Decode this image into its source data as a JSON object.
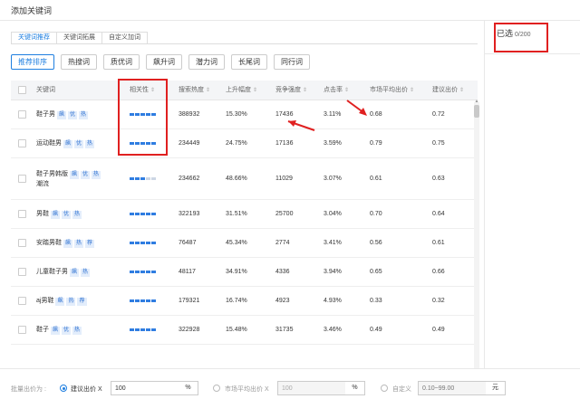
{
  "dialog": {
    "title": "添加关键词"
  },
  "tabs": [
    "关键词推荐",
    "关键词拓展",
    "自定义加词"
  ],
  "filters": [
    "推荐排序",
    "热搜词",
    "质优词",
    "飙升词",
    "潜力词",
    "长尾词",
    "同行词"
  ],
  "table": {
    "columns": [
      "关键词",
      "相关性",
      "搜索热度",
      "上升幅度",
      "竞争强度",
      "点击率",
      "市场平均出价",
      "建议出价"
    ],
    "rows": [
      {
        "keyword": "鞋子男",
        "keyword_line2": "",
        "badges": [
          "飙",
          "优",
          "热"
        ],
        "relevance_level": 5,
        "heat": "388932",
        "rise": "15.30%",
        "competition": "17436",
        "ctr": "3.11%",
        "avg_bid": "0.68",
        "suggest_bid": "0.72"
      },
      {
        "keyword": "运动鞋男",
        "keyword_line2": "",
        "badges": [
          "飙",
          "优",
          "热"
        ],
        "relevance_level": 5,
        "heat": "234449",
        "rise": "24.75%",
        "competition": "17136",
        "ctr": "3.59%",
        "avg_bid": "0.79",
        "suggest_bid": "0.75"
      },
      {
        "keyword": "鞋子男韩版",
        "keyword_line2": "潮流",
        "badges": [
          "飙",
          "优",
          "热"
        ],
        "relevance_level": 3,
        "heat": "234662",
        "rise": "48.66%",
        "competition": "11029",
        "ctr": "3.07%",
        "avg_bid": "0.61",
        "suggest_bid": "0.63"
      },
      {
        "keyword": "男鞋",
        "keyword_line2": "",
        "badges": [
          "飙",
          "优",
          "热"
        ],
        "relevance_level": 5,
        "heat": "322193",
        "rise": "31.51%",
        "competition": "25700",
        "ctr": "3.04%",
        "avg_bid": "0.70",
        "suggest_bid": "0.64"
      },
      {
        "keyword": "安踏男鞋",
        "keyword_line2": "",
        "badges": [
          "飙",
          "热",
          "荐"
        ],
        "relevance_level": 5,
        "heat": "76487",
        "rise": "45.34%",
        "competition": "2774",
        "ctr": "3.41%",
        "avg_bid": "0.56",
        "suggest_bid": "0.61"
      },
      {
        "keyword": "儿童鞋子男",
        "keyword_line2": "",
        "badges": [
          "飙",
          "热"
        ],
        "relevance_level": 5,
        "heat": "48117",
        "rise": "34.91%",
        "competition": "4336",
        "ctr": "3.94%",
        "avg_bid": "0.65",
        "suggest_bid": "0.66"
      },
      {
        "keyword": "aj男鞋",
        "keyword_line2": "",
        "badges": [
          "飙",
          "热",
          "荐"
        ],
        "relevance_level": 5,
        "heat": "179321",
        "rise": "16.74%",
        "competition": "4923",
        "ctr": "4.93%",
        "avg_bid": "0.33",
        "suggest_bid": "0.32"
      },
      {
        "keyword": "鞋子",
        "keyword_line2": "",
        "badges": [
          "飙",
          "优",
          "热"
        ],
        "relevance_level": 5,
        "heat": "322928",
        "rise": "15.48%",
        "competition": "31735",
        "ctr": "3.46%",
        "avg_bid": "0.49",
        "suggest_bid": "0.49"
      }
    ]
  },
  "selected": {
    "label": "已选",
    "count": "0/200"
  },
  "bid": {
    "label": "批量出价为 :",
    "options": [
      {
        "label": "建议出价 X",
        "value": "100",
        "unit": "%"
      },
      {
        "label": "市场平均出价 X",
        "value": "100",
        "unit": "%"
      },
      {
        "label": "自定义",
        "placeholder": "0.10~99.00",
        "unit": "元"
      }
    ]
  },
  "colors": {
    "accent": "#1f7fe0",
    "highlight": "#e02020",
    "relevance_bar": "#2f7de1"
  }
}
